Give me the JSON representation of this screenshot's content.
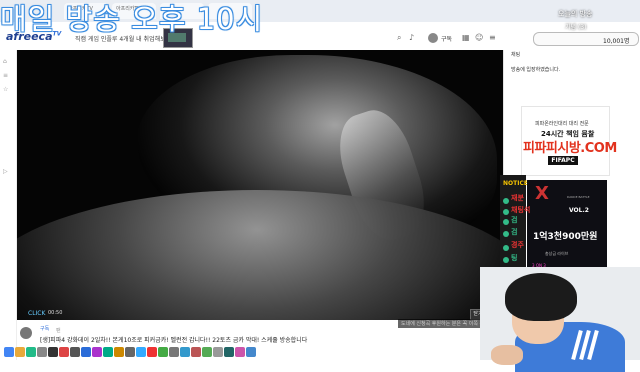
{
  "overlay_title": "매일 방송 오후 10시",
  "browser": {
    "tabs": [
      "아프리카TV",
      "아프리카TV",
      "",
      ""
    ]
  },
  "header": {
    "logo": "afreeca",
    "logo_tv": "TV",
    "promo_text": "직캠 게임 인플루 4개월 내 취업해보세요!",
    "user_name": "구독",
    "icons": [
      "search-icon",
      "bell-icon",
      "grid-icon",
      "user-icon"
    ]
  },
  "top_right_overlay": {
    "line1": "오늘의 방송",
    "line2": "기념 (3)",
    "line3": "10,001명"
  },
  "video": {
    "click_label": "CLICK",
    "time": "00:50",
    "hint": "도네에 신청곡 후원하는 분은 꼭 이쪽 후원해주세요",
    "hint_btn": "닫기"
  },
  "channel": {
    "name": "구독",
    "badge": "팬",
    "title": "[생]피파4 강화데이 2일차!! 본게10조로 피커금카! 벨런전 갑니다!! 22토츠 금카 막대! 스케쥴 방송합니다"
  },
  "chat": {
    "header": "채팅",
    "welcome": "방송에 입장하였습니다.",
    "notice": "NOTICE",
    "nicks": [
      {
        "text": "재분",
        "color": "#e33"
      },
      {
        "text": "채팅석",
        "color": "#e33"
      },
      {
        "text": "검",
        "color": "#3b8"
      },
      {
        "text": "검",
        "color": "#3b8"
      },
      {
        "text": "경주",
        "color": "#e33"
      },
      {
        "text": "팅",
        "color": "#3b8"
      }
    ]
  },
  "ad1": {
    "top": "피파온라인대리 대리 전문",
    "mid": "24시간 책임 뮴찰",
    "main": "피파피시방.COM",
    "logo": "FIFAPC"
  },
  "ad2": {
    "x": "X",
    "game": "DANCE BATTLE",
    "vol": "VOL.2",
    "prize": "1억3천900만원",
    "sub": "총상금 라이브",
    "foot": "3 ON 3"
  },
  "bottom_icons": [
    "chrome-icon",
    "folder-icon",
    "edge-icon",
    "store-icon",
    "mail-icon",
    "app-icon",
    "app-icon",
    "app-icon",
    "app-icon",
    "app-icon",
    "app-icon",
    "app-icon",
    "app-icon",
    "app-icon",
    "app-icon",
    "app-icon",
    "app-icon",
    "app-icon",
    "app-icon",
    "app-icon",
    "app-icon",
    "app-icon",
    "app-icon"
  ]
}
